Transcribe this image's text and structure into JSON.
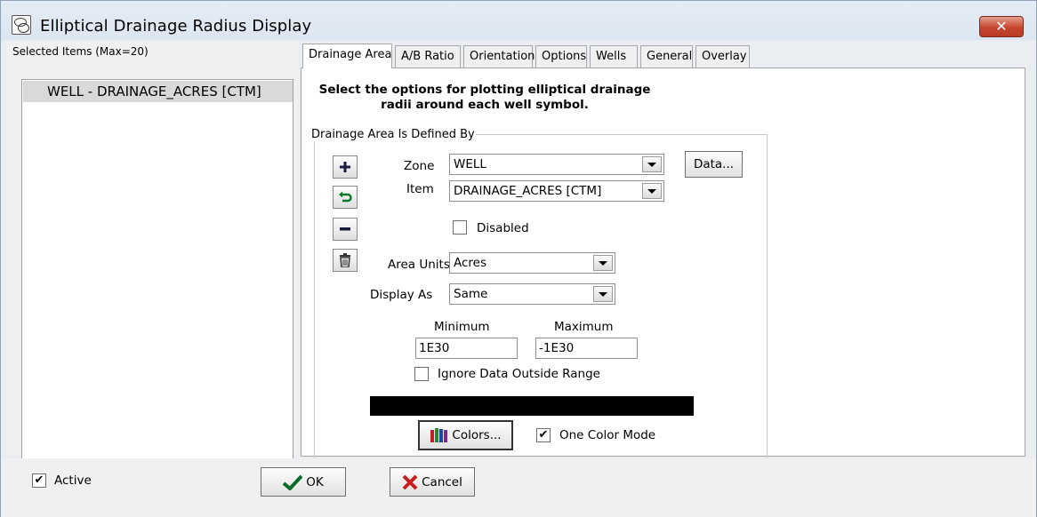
{
  "window": {
    "title": "Elliptical Drainage Radius Display",
    "close_label": "✕"
  },
  "left": {
    "selected_label": "Selected Items (Max=20)",
    "items": [
      "WELL - DRAINAGE_ACRES [CTM]"
    ]
  },
  "tabs": [
    {
      "label": "Drainage Area",
      "active": true
    },
    {
      "label": "A/B Ratio"
    },
    {
      "label": "Orientation"
    },
    {
      "label": "Options"
    },
    {
      "label": "Wells"
    },
    {
      "label": "General"
    },
    {
      "label": "Overlay"
    }
  ],
  "drainage": {
    "instruction_line1": "Select the options for plotting elliptical drainage",
    "instruction_line2": "radii around each well symbol.",
    "group_label": "Drainage Area Is Defined By",
    "zone_label": "Zone",
    "zone_value": "WELL",
    "item_label": "Item",
    "item_value": "DRAINAGE_ACRES  [CTM]",
    "data_button": "Data...",
    "disabled_label": "Disabled",
    "area_units_label": "Area Units",
    "area_units_value": "Acres",
    "display_as_label": "Display As",
    "display_as_value": "Same",
    "minimum_label": "Minimum",
    "minimum_value": "1E30",
    "maximum_label": "Maximum",
    "maximum_value": "-1E30",
    "ignore_label": "Ignore Data Outside Range",
    "colors_button": "Colors...",
    "one_color_label": "One Color Mode",
    "one_color_checked": "✔",
    "color_bar": "#000000"
  },
  "bottom": {
    "active_label": "Active",
    "active_checked": "✔",
    "ok_label": "OK",
    "cancel_label": "Cancel"
  }
}
